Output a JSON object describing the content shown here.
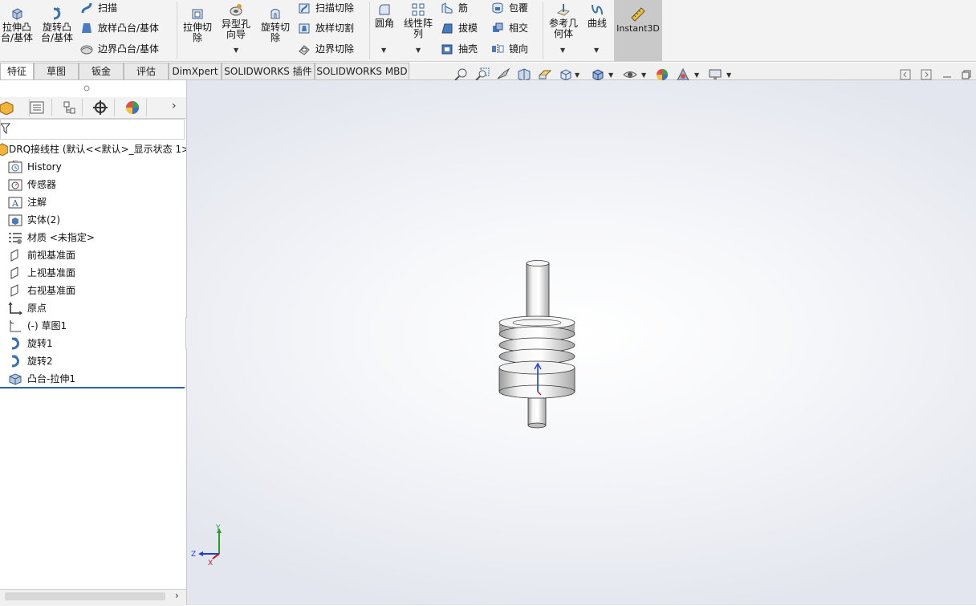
{
  "ribbon": {
    "extrude_boss": "拉伸凸\n台/基体",
    "revolve_boss": "旋转凸\n台/基体",
    "sweep": "扫描",
    "loft_boss": "放样凸台/基体",
    "boundary_boss": "边界凸台/基体",
    "extrude_cut": "拉伸切\n除",
    "hole_wizard": "异型孔\n向导",
    "revolve_cut": "旋转切\n除",
    "sweep_cut": "扫描切除",
    "loft_cut": "放样切割",
    "boundary_cut": "边界切除",
    "fillet": "圆角",
    "linear_pattern": "线性阵\n列",
    "rib": "筋",
    "draft": "拔模",
    "shell": "抽壳",
    "wrap": "包覆",
    "intersect": "相交",
    "mirror": "镜向",
    "ref_geometry": "参考几\n何体",
    "curves": "曲线",
    "instant3d": "Instant3D"
  },
  "tabs": [
    {
      "label": "特征",
      "active": true
    },
    {
      "label": "草图"
    },
    {
      "label": "钣金"
    },
    {
      "label": "评估"
    },
    {
      "label": "DimXpert"
    },
    {
      "label": "SOLIDWORKS 插件"
    },
    {
      "label": "SOLIDWORKS MBD"
    }
  ],
  "tree": {
    "root": "DRQ接线柱 (默认<<默认>_显示状态 1>",
    "items": [
      {
        "label": "History",
        "icon": "history-icon"
      },
      {
        "label": "传感器",
        "icon": "sensor-icon"
      },
      {
        "label": "注解",
        "icon": "annotation-icon"
      },
      {
        "label": "实体(2)",
        "icon": "solid-bodies-icon"
      },
      {
        "label": "材质 <未指定>",
        "icon": "material-icon"
      },
      {
        "label": "前视基准面",
        "icon": "plane-icon"
      },
      {
        "label": "上视基准面",
        "icon": "plane-icon"
      },
      {
        "label": "右视基准面",
        "icon": "plane-icon"
      },
      {
        "label": "原点",
        "icon": "origin-icon"
      },
      {
        "label": "(-) 草图1",
        "icon": "sketch-icon"
      },
      {
        "label": "旋转1",
        "icon": "revolve-icon"
      },
      {
        "label": "旋转2",
        "icon": "revolve-icon"
      },
      {
        "label": "凸台-拉伸1",
        "icon": "extrude-icon"
      }
    ]
  },
  "triad": {
    "x": "X",
    "y": "Y",
    "z": "Z"
  },
  "colors": {
    "accent": "#2b5fb5",
    "ribbon_bg": "#f3f3f3",
    "instant3d_bg": "#c9c9c9"
  }
}
